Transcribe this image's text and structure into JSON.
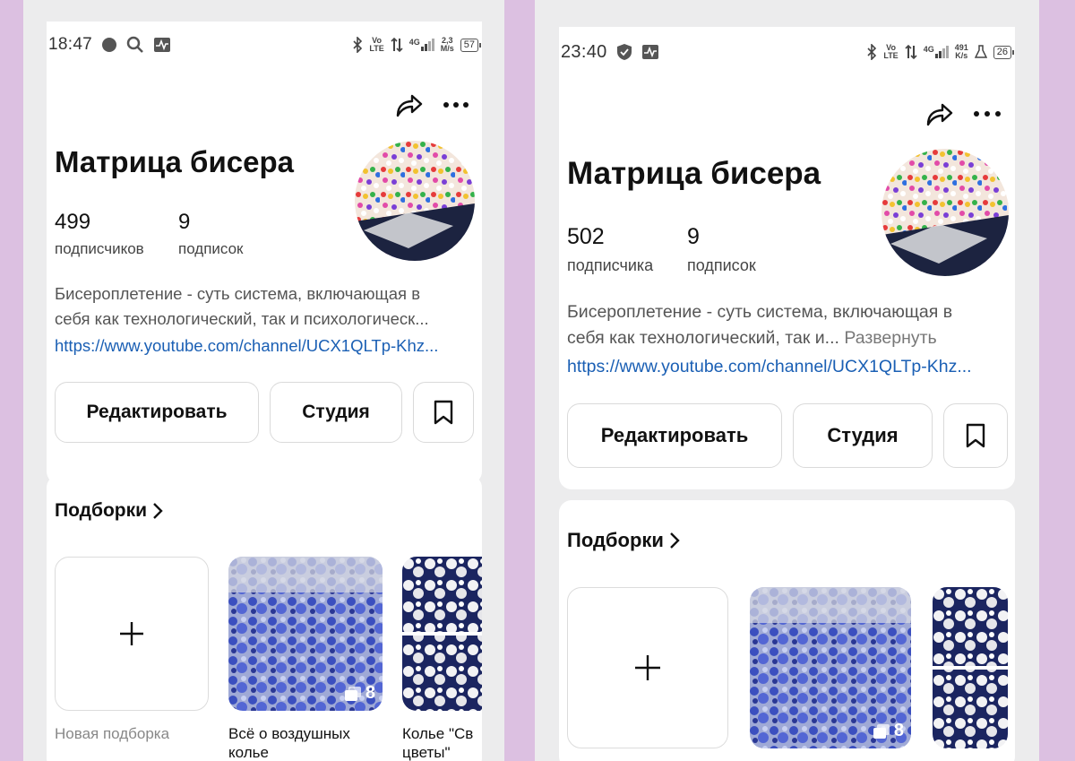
{
  "screens": [
    {
      "status": {
        "time": "18:47",
        "lte_top": "Vo",
        "lte_bottom": "LTE",
        "net_gen": "4G",
        "speed_top": "2,3",
        "speed_bottom": "M/s",
        "battery": "57"
      },
      "profile": {
        "name": "Матрица бисера",
        "followers_count": "499",
        "followers_label": "подписчиков",
        "following_count": "9",
        "following_label": "подписок"
      },
      "bio": {
        "line1": "Бисероплетение  - суть система, включающая в",
        "line2": "себя как технологический, так и психологическ...",
        "expand": ""
      },
      "link": "https://www.youtube.com/channel/UCX1QLTp-Khz...",
      "buttons": {
        "edit": "Редактировать",
        "studio": "Студия"
      },
      "collections": {
        "title": "Подборки",
        "new_label": "Новая подборка",
        "items": [
          {
            "label_line1": "Всё о воздушных",
            "label_line2": "колье",
            "count": "8"
          },
          {
            "label_line1": "Колье \"Св",
            "label_line2": "цветы\"",
            "count": ""
          }
        ]
      }
    },
    {
      "status": {
        "time": "23:40",
        "lte_top": "Vo",
        "lte_bottom": "LTE",
        "net_gen": "4G",
        "speed_top": "491",
        "speed_bottom": "K/s",
        "battery": "26"
      },
      "profile": {
        "name": "Матрица бисера",
        "followers_count": "502",
        "followers_label": "подписчика",
        "following_count": "9",
        "following_label": "подписок"
      },
      "bio": {
        "line1": "Бисероплетение  - суть система, включающая в",
        "line2": "себя как технологический, так и...",
        "expand": " Развернуть"
      },
      "link": "https://www.youtube.com/channel/UCX1QLTp-Khz...",
      "buttons": {
        "edit": "Редактировать",
        "studio": "Студия"
      },
      "collections": {
        "title": "Подборки",
        "new_label": "",
        "items": [
          {
            "label_line1": "",
            "label_line2": "",
            "count": "8"
          },
          {
            "label_line1": "",
            "label_line2": "",
            "count": ""
          }
        ]
      }
    }
  ],
  "icons": {
    "share": "share-arrow-icon",
    "more": "more-dots-icon",
    "bookmark": "bookmark-icon",
    "chevron": "chevron-right-icon",
    "plus": "plus-icon",
    "stack": "stack-icon"
  },
  "colors": {
    "background": "#dcc0e1",
    "frame": "#ececed",
    "link": "#1a5fb4",
    "border": "#dadada"
  }
}
